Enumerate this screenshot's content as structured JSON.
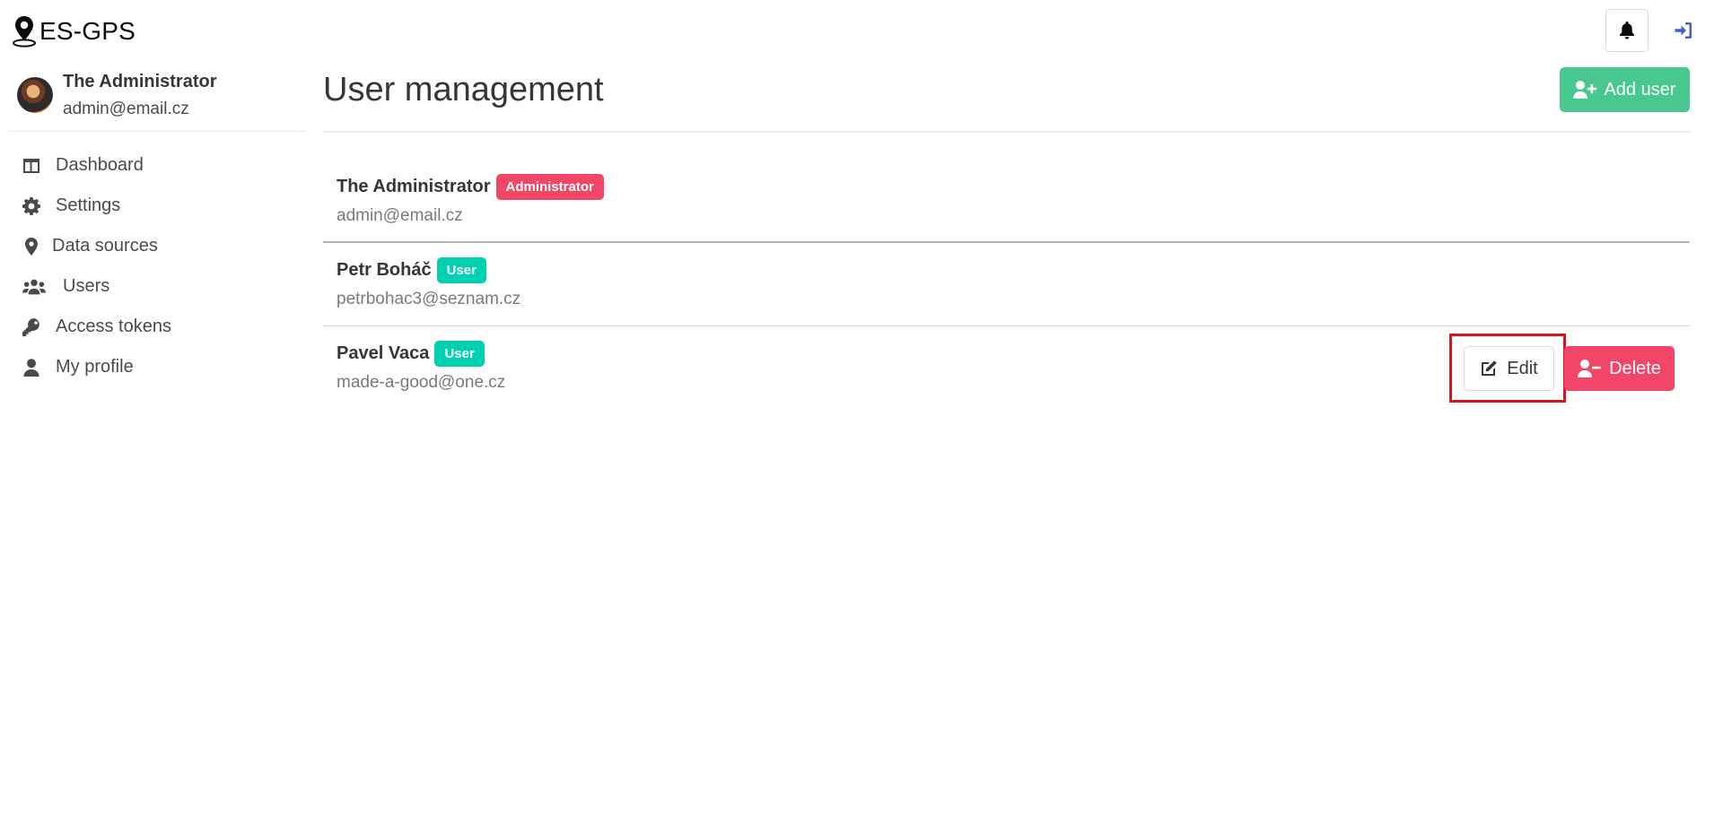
{
  "app": {
    "name": "ES-GPS"
  },
  "header": {
    "notifications_icon": "bell-icon",
    "logout_icon": "sign-in-icon",
    "colors": {
      "logout": "#485fc7"
    }
  },
  "sidebar": {
    "profile": {
      "name": "The Administrator",
      "email": "admin@email.cz"
    },
    "items": [
      {
        "label": "Dashboard",
        "icon": "table-columns-icon"
      },
      {
        "label": "Settings",
        "icon": "gear-icon"
      },
      {
        "label": "Data sources",
        "icon": "map-pin-icon"
      },
      {
        "label": "Users",
        "icon": "users-icon"
      },
      {
        "label": "Access tokens",
        "icon": "key-icon"
      },
      {
        "label": "My profile",
        "icon": "user-icon"
      }
    ]
  },
  "main": {
    "title": "User management",
    "add_user_label": "Add user",
    "users": [
      {
        "name": "The Administrator",
        "role": "Administrator",
        "email": "admin@email.cz"
      },
      {
        "name": "Petr Boháč",
        "role": "User",
        "email": "petrbohac3@seznam.cz"
      },
      {
        "name": "Pavel Vaca",
        "role": "User",
        "email": "made-a-good@one.cz",
        "actions": {
          "edit": "Edit",
          "delete": "Delete"
        }
      }
    ]
  },
  "colors": {
    "success": "#48c78e",
    "danger": "#f14668",
    "primary": "#00d1b2",
    "highlight": "#e0101f"
  }
}
